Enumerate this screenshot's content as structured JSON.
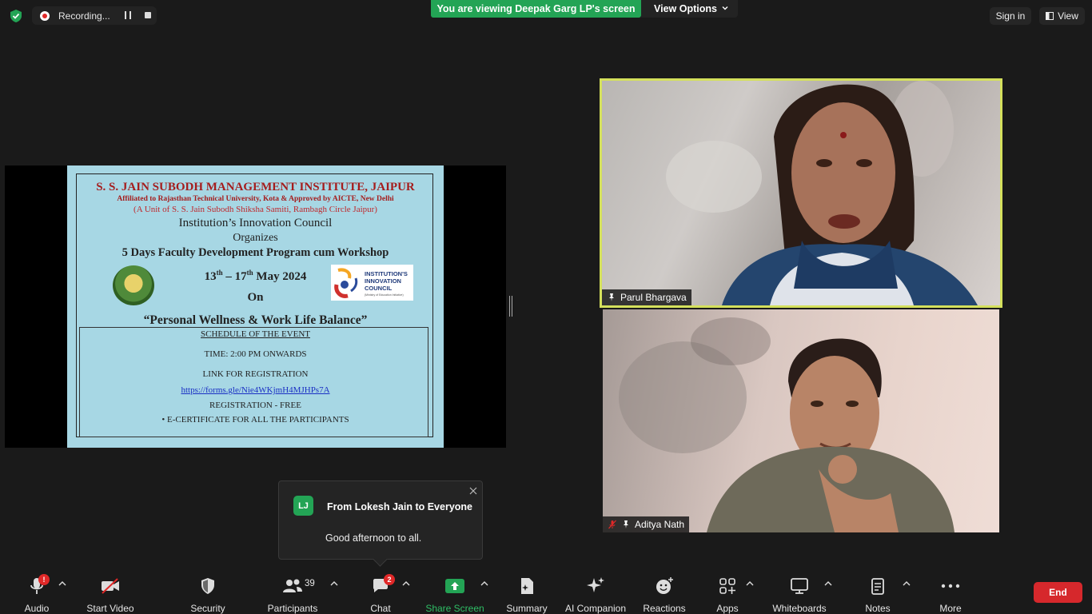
{
  "topbar": {
    "recording_label": "Recording...",
    "viewing_banner": "You are viewing Deepak Garg LP's screen",
    "view_options_label": "View Options",
    "signin_label": "Sign in",
    "view_label": "View"
  },
  "slide": {
    "title": "S. S. JAIN SUBODH MANAGEMENT INSTITUTE, JAIPUR",
    "affiliation": "Affiliated to Rajasthan Technical University, Kota & Approved by AICTE, New Delhi",
    "unit": "(A Unit of S. S. Jain Subodh Shiksha Samiti, Rambagh Circle Jaipur)",
    "council": "Institution’s Innovation Council",
    "organizes": "Organizes",
    "program": "5 Days Faculty Development Program cum Workshop",
    "date_start": "13",
    "date_start_sup": "th",
    "date_sep": " – 17",
    "date_end_sup": "th",
    "date_rest": " May 2024",
    "on": "On",
    "theme": "“Personal Wellness & Work Life Balance”",
    "schedule_heading": "SCHEDULE OF THE EVENT",
    "time": "TIME: 2:00 PM ONWARDS",
    "link_label": "LINK FOR REGISTRATION",
    "link": "https://forms.gle/Nie4WKjmH4MJHPs7A",
    "registration": "REGISTRATION - FREE",
    "certificate": "E-CERTIFICATE FOR ALL THE PARTICIPANTS",
    "iic_logo_text": [
      "INSTITUTION'S",
      "INNOVATION",
      "COUNCIL"
    ],
    "iic_logo_sub": "(Ministry of Education Initiative)"
  },
  "participants_tiles": [
    {
      "name": "Parul Bhargava",
      "active_speaker": true
    },
    {
      "name": "Aditya Nath",
      "muted": true
    }
  ],
  "chat_toast": {
    "avatar_initials": "LJ",
    "from": "From Lokesh Jain to Everyone",
    "message": "Good afternoon to all."
  },
  "toolbar": {
    "audio": "Audio",
    "start_video": "Start Video",
    "security": "Security",
    "participants": "Participants",
    "participants_count": "39",
    "chat": "Chat",
    "chat_badge": "2",
    "share_screen": "Share Screen",
    "summary": "Summary",
    "ai_companion": "AI Companion",
    "reactions": "Reactions",
    "apps": "Apps",
    "whiteboards": "Whiteboards",
    "notes": "Notes",
    "more": "More",
    "end": "End",
    "audio_badge": "!"
  },
  "colors": {
    "accent_green": "#23a455",
    "end_red": "#d6282c",
    "active_speaker_border": "#d4e05c"
  }
}
